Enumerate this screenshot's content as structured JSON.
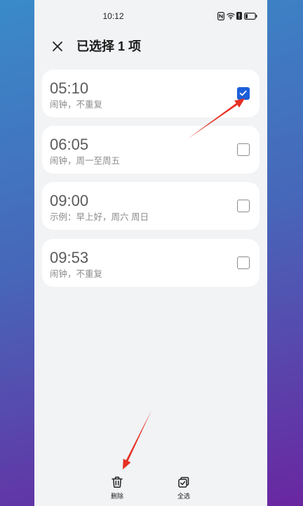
{
  "status_bar": {
    "time": "10:12",
    "icons": [
      "nfc-icon",
      "wifi-icon",
      "alert-icon",
      "battery-icon"
    ]
  },
  "header": {
    "close_icon": "close-icon",
    "title": "已选择 1 项"
  },
  "alarms": [
    {
      "time": "05:10",
      "description": "闹钟，不重复",
      "selected": true
    },
    {
      "time": "06:05",
      "description": "闹钟，周一至周五",
      "selected": false
    },
    {
      "time": "09:00",
      "description": "示例：早上好，周六 周日",
      "selected": false
    },
    {
      "time": "09:53",
      "description": "闹钟，不重复",
      "selected": false
    }
  ],
  "bottom_bar": {
    "delete": {
      "icon": "trash-icon",
      "label": "删除"
    },
    "select_all": {
      "icon": "select-all-icon",
      "label": "全选"
    }
  },
  "colors": {
    "accent": "#1c5fd9",
    "annotation": "#e53023",
    "screen_bg": "#f1f3f5",
    "card_bg": "#ffffff"
  }
}
